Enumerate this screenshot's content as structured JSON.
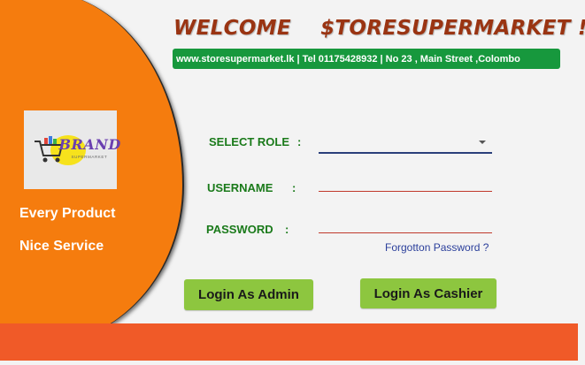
{
  "header": {
    "welcome": "WELCOME    $TORESUPERMARKET !",
    "info": "www.storesupermarket.lk  | Tel 01175428932 | No 23 , Main Street ,Colombo"
  },
  "logo": {
    "brand": "BRAND",
    "subtitle": "SUPERMARKET"
  },
  "taglines": [
    "Every Product",
    "Nice Service"
  ],
  "form": {
    "role_label": "SELECT ROLE",
    "username_label": "USERNAME",
    "password_label": "PASSWORD",
    "colon": ":",
    "role_value": "",
    "username_value": "",
    "password_value": "",
    "forgot_link": "Forgotton Password ?"
  },
  "buttons": {
    "admin": "Login As Admin",
    "cashier": "Login As Cashier"
  },
  "colors": {
    "panel_orange": "#f57c0e",
    "info_green": "#17983d",
    "button_green": "#8dc63f",
    "footer_orange": "#f05a28",
    "label_green": "#1a7a1a",
    "welcome_brown": "#9a3412"
  }
}
